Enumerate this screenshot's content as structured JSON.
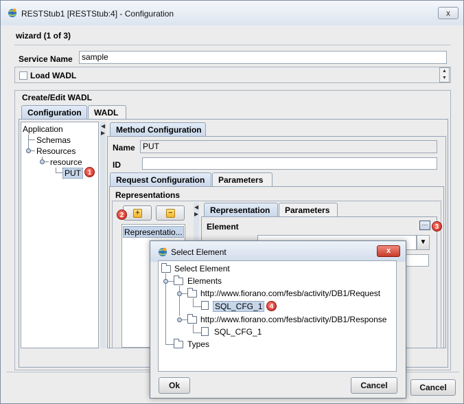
{
  "window": {
    "title": "RESTStub1 [RESTStub:4] - Configuration",
    "close_glyph": "x"
  },
  "wizard": {
    "step_label": "wizard (1 of 3)"
  },
  "service": {
    "name_label": "Service Name",
    "name_value": "sample",
    "load_wadl_label": "Load WADL",
    "load_wadl_checked": false
  },
  "wadl_panel": {
    "group_title": "Create/Edit WADL",
    "tabs": [
      {
        "label": "Configuration",
        "active": true
      },
      {
        "label": "WADL",
        "active": false
      }
    ]
  },
  "tree": {
    "items": [
      "Application",
      "Schemas",
      "Resources",
      "resource",
      "PUT"
    ]
  },
  "method_config": {
    "tab_label": "Method Configuration",
    "name_label": "Name",
    "name_value": "PUT",
    "id_label": "ID",
    "id_value": "",
    "subtabs": [
      {
        "label": "Request Configuration",
        "active": true
      },
      {
        "label": "Parameters",
        "active": false
      }
    ],
    "representations_title": "Representations",
    "plus_glyph": "+",
    "minus_glyph": "−",
    "representation_list": [
      "Representatio..."
    ],
    "rep_tabs": [
      {
        "label": "Representation",
        "active": true
      },
      {
        "label": "Parameters",
        "active": false
      }
    ],
    "element_label": "Element",
    "ellipsis_glyph": "···",
    "dropdown_arrow": "▼"
  },
  "badges": [
    "1",
    "2",
    "3",
    "4"
  ],
  "footer": {
    "cancel_label": "Cancel"
  },
  "dialog": {
    "title": "Select Element",
    "close_glyph": "x",
    "tree": {
      "root": "Select Element",
      "elements": "Elements",
      "request_ns": "http://www.fiorano.com/fesb/activity/DB1/Request",
      "request_item": "SQL_CFG_1",
      "response_ns": "http://www.fiorano.com/fesb/activity/DB1/Response",
      "response_item": "SQL_CFG_1",
      "types": "Types"
    },
    "ok_label": "Ok",
    "cancel_label": "Cancel"
  },
  "colors": {
    "badge": "#c8201a",
    "selection": "#c6d6ea",
    "tab_active": "#c9d8ea"
  }
}
